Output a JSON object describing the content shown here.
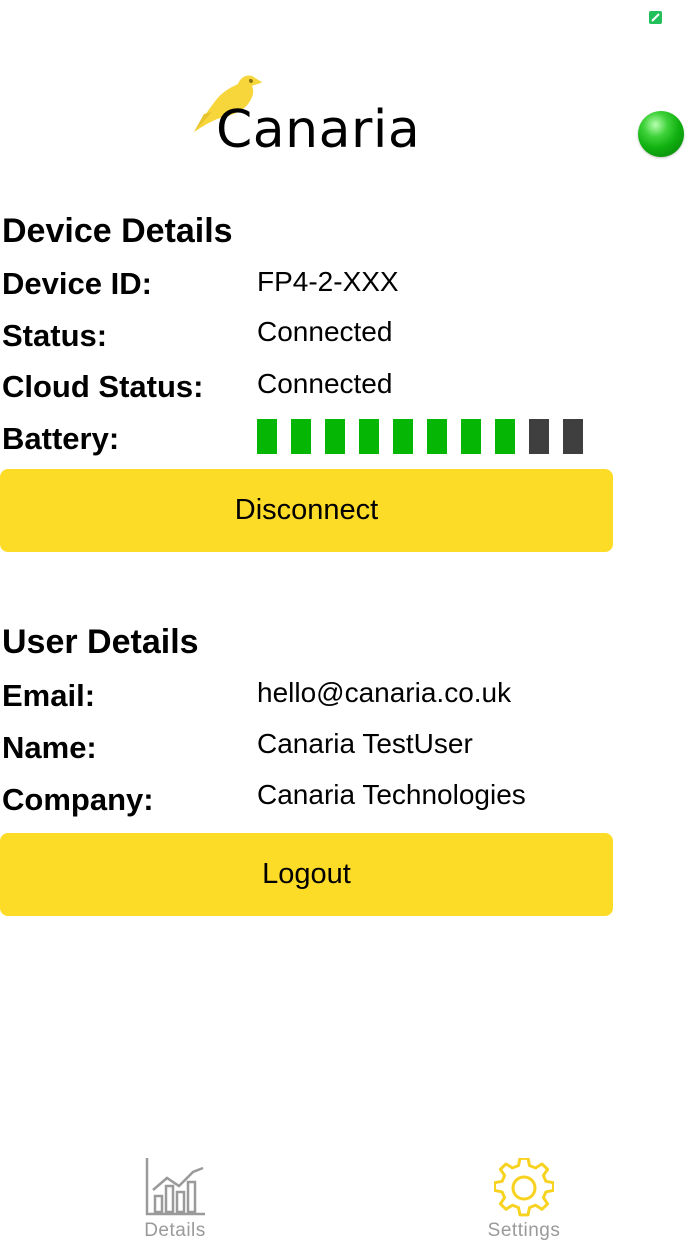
{
  "app": {
    "logo_text": "Canaria",
    "accent_color": "#fddc27",
    "connection_color": "#10b010"
  },
  "device": {
    "title": "Device Details",
    "rows": [
      {
        "label": "Device ID:",
        "value": "FP4-2-XXX"
      },
      {
        "label": "Status:",
        "value": "Connected"
      },
      {
        "label": "Cloud Status:",
        "value": "Connected"
      }
    ],
    "battery_label": "Battery:",
    "battery_level": 0.8,
    "battery_segments_filled": 8,
    "battery_segments_total": 10,
    "disconnect_label": "Disconnect"
  },
  "user": {
    "title": "User Details",
    "rows": [
      {
        "label": "Email:",
        "value": "hello@canaria.co.uk"
      },
      {
        "label": "Name:",
        "value": "Canaria TestUser"
      },
      {
        "label": "Company:",
        "value": "Canaria Technologies"
      }
    ],
    "logout_label": "Logout"
  },
  "tabs": [
    {
      "label": "Details",
      "icon": "bar-chart-icon",
      "active": false
    },
    {
      "label": "Settings",
      "icon": "gear-icon",
      "active": true
    }
  ]
}
